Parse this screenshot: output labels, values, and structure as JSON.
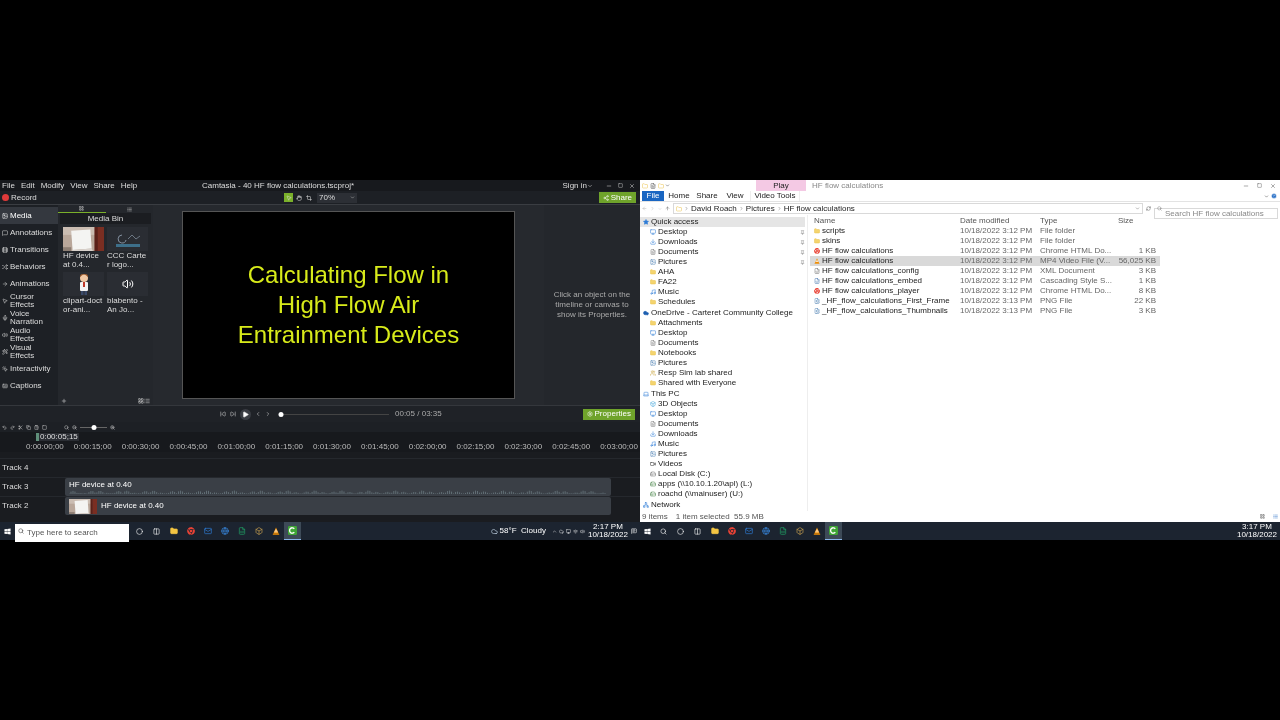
{
  "camtasia": {
    "menu": [
      "File",
      "Edit",
      "Modify",
      "View",
      "Share",
      "Help"
    ],
    "title": "Camtasia - 40 HF flow calculations.tscproj*",
    "sign_in": "Sign in",
    "record": "Record",
    "tools": [
      {
        "kind": "select",
        "selected": true
      },
      {
        "kind": "pan",
        "selected": false
      },
      {
        "kind": "crop",
        "selected": false
      }
    ],
    "zoom": "70%",
    "share": "Share",
    "sidebar": [
      {
        "label": "Media",
        "kind": "media",
        "selected": true
      },
      {
        "label": "Annotations",
        "kind": "annotations",
        "selected": false
      },
      {
        "label": "Transitions",
        "kind": "transitions",
        "selected": false
      },
      {
        "label": "Behaviors",
        "kind": "behaviors",
        "selected": false
      },
      {
        "label": "Animations",
        "kind": "animations",
        "selected": false
      },
      {
        "label": "Cursor Effects",
        "kind": "cursor",
        "selected": false
      },
      {
        "label": "Voice Narration",
        "kind": "mic",
        "selected": false
      },
      {
        "label": "Audio Effects",
        "kind": "audio",
        "selected": false
      },
      {
        "label": "Visual Effects",
        "kind": "visual",
        "selected": false
      },
      {
        "label": "Interactivity",
        "kind": "interactivity",
        "selected": false
      },
      {
        "label": "Captions",
        "kind": "captions",
        "selected": false
      }
    ],
    "media_bin": {
      "tabs": [
        {
          "kind": "bin",
          "selected": true
        },
        {
          "kind": "list",
          "selected": false
        }
      ],
      "title": "Media Bin",
      "items": [
        {
          "kind": "video",
          "label": "HF device at 0.4..."
        },
        {
          "kind": "logo",
          "label": "CCC Carter logo..."
        },
        {
          "kind": "clipart",
          "label": "clipart-doctor-ani..."
        },
        {
          "kind": "audio",
          "label": "blabento - An Jo..."
        }
      ]
    },
    "slide": {
      "lines": [
        "Calculating Flow in",
        "High Flow Air",
        "Entrainment Devices"
      ]
    },
    "properties_hint": "Click an object on the timeline or canvas to show its Properties.",
    "scrubber": {
      "level": 0.02
    },
    "time": "00:05 / 03:35",
    "properties_button": "Properties",
    "zoom_slider": {
      "level": 0.5
    },
    "playhead": "0:00:05;15",
    "ruler": [
      "0:00:00;00",
      "0:00:15;00",
      "0:00:30;00",
      "0:00:45;00",
      "0:01:00;00",
      "0:01:15;00",
      "0:01:30;00",
      "0:01:45;00",
      "0:02:00;00",
      "0:02:15;00",
      "0:02:30;00",
      "0:02:45;00",
      "0:03:00;00"
    ],
    "tracks": [
      {
        "name": "Track 4"
      },
      {
        "name": "Track 3",
        "clip": {
          "kind": "audio",
          "label": "HF device at 0.40"
        }
      },
      {
        "name": "Track 2",
        "clip": {
          "kind": "video",
          "label": "HF device at 0.40"
        }
      }
    ]
  },
  "left_taskbar": {
    "search": {
      "placeholder": "Type here to search"
    },
    "apps": [
      {
        "kind": "cortana",
        "selected": false
      },
      {
        "kind": "taskview",
        "selected": false
      },
      {
        "kind": "explorer",
        "selected": false
      },
      {
        "kind": "chrome",
        "selected": false
      },
      {
        "kind": "outlook",
        "selected": false
      },
      {
        "kind": "globe",
        "selected": false
      },
      {
        "kind": "excel",
        "selected": false
      },
      {
        "kind": "app",
        "selected": false
      },
      {
        "kind": "vlc",
        "selected": false
      },
      {
        "kind": "camtasia",
        "selected": true
      }
    ],
    "weather": "58°F  Cloudy",
    "time": "2:17 PM",
    "date": "10/18/2022"
  },
  "explorer": {
    "title": "HF flow calculations",
    "contextual_group": "Play",
    "ribbon_tabs": [
      {
        "label": "File",
        "kind": "file"
      },
      {
        "label": "Home",
        "kind": "tab"
      },
      {
        "label": "Share",
        "kind": "tab"
      },
      {
        "label": "View",
        "kind": "tab"
      },
      {
        "label": "Video Tools",
        "kind": "contextual"
      }
    ],
    "path": [
      "David Roach",
      "Pictures",
      "HF flow calculations"
    ],
    "search": {
      "placeholder": "Search HF flow calculations"
    },
    "nav": [
      {
        "label": "Quick access",
        "kind": "star",
        "selected": true,
        "children": [
          {
            "label": "Desktop",
            "kind": "desktop",
            "pinned": true,
            "selected": false
          },
          {
            "label": "Downloads",
            "kind": "download",
            "pinned": true,
            "selected": false
          },
          {
            "label": "Documents",
            "kind": "document",
            "pinned": true,
            "selected": false
          },
          {
            "label": "Pictures",
            "kind": "pictures",
            "pinned": true,
            "selected": false
          },
          {
            "label": "AHA",
            "kind": "folder",
            "pinned": false,
            "selected": false
          },
          {
            "label": "FA22",
            "kind": "folder",
            "pinned": false,
            "selected": false
          },
          {
            "label": "Music",
            "kind": "music",
            "pinned": false,
            "selected": false
          },
          {
            "label": "Schedules",
            "kind": "folder",
            "pinned": false,
            "selected": false
          }
        ]
      },
      {
        "label": "OneDrive - Carteret Community College",
        "kind": "cloud",
        "selected": false,
        "children": [
          {
            "label": "Attachments",
            "kind": "folder",
            "selected": false
          },
          {
            "label": "Desktop",
            "kind": "desktop",
            "selected": false
          },
          {
            "label": "Documents",
            "kind": "document",
            "selected": false
          },
          {
            "label": "Notebooks",
            "kind": "folder",
            "selected": false
          },
          {
            "label": "Pictures",
            "kind": "pictures",
            "selected": false
          },
          {
            "label": "Resp Sim lab shared",
            "kind": "shared",
            "selected": false
          },
          {
            "label": "Shared with Everyone",
            "kind": "folder",
            "selected": false
          }
        ]
      },
      {
        "label": "This PC",
        "kind": "pc",
        "selected": false,
        "children": [
          {
            "label": "3D Objects",
            "kind": "objects",
            "selected": false
          },
          {
            "label": "Desktop",
            "kind": "desktop",
            "selected": false
          },
          {
            "label": "Documents",
            "kind": "document",
            "selected": false
          },
          {
            "label": "Downloads",
            "kind": "download",
            "selected": false
          },
          {
            "label": "Music",
            "kind": "music",
            "selected": false
          },
          {
            "label": "Pictures",
            "kind": "pictures",
            "selected": false
          },
          {
            "label": "Videos",
            "kind": "videos",
            "selected": false
          },
          {
            "label": "Local Disk (C:)",
            "kind": "disk",
            "selected": false
          },
          {
            "label": "apps (\\\\10.10.1.20\\apl) (L:)",
            "kind": "netdrive",
            "selected": false
          },
          {
            "label": "roachd (\\\\mainuser) (U:)",
            "kind": "netdrive",
            "selected": false
          }
        ]
      },
      {
        "label": "Network",
        "kind": "network",
        "selected": false
      }
    ],
    "columns": [
      "Name",
      "Date modified",
      "Type",
      "Size"
    ],
    "rows": [
      {
        "kind": "folder",
        "name": "scripts",
        "date": "10/18/2022 3:12 PM",
        "type": "File folder",
        "selected": false
      },
      {
        "kind": "folder",
        "name": "skins",
        "date": "10/18/2022 3:12 PM",
        "type": "File folder",
        "selected": false
      },
      {
        "kind": "chrome",
        "name": "HF flow calculations",
        "date": "10/18/2022 3:12 PM",
        "type": "Chrome HTML Do...",
        "size": "1 KB",
        "selected": false
      },
      {
        "kind": "vlc",
        "name": "HF flow calculations",
        "date": "10/18/2022 3:12 PM",
        "type": "MP4 Video File (V...",
        "size": "56,025 KB",
        "selected": true
      },
      {
        "kind": "xml",
        "name": "HF flow calculations_config",
        "date": "10/18/2022 3:12 PM",
        "type": "XML Document",
        "size": "3 KB",
        "selected": false
      },
      {
        "kind": "css",
        "name": "HF flow calculations_embed",
        "date": "10/18/2022 3:12 PM",
        "type": "Cascading Style S...",
        "size": "1 KB",
        "selected": false
      },
      {
        "kind": "chrome",
        "name": "HF flow calculations_player",
        "date": "10/18/2022 3:12 PM",
        "type": "Chrome HTML Do...",
        "size": "8 KB",
        "selected": false
      },
      {
        "kind": "png",
        "name": "_HF_flow_calculations_First_Frame",
        "date": "10/18/2022 3:13 PM",
        "type": "PNG File",
        "size": "22 KB",
        "selected": false
      },
      {
        "kind": "png",
        "name": "_HF_flow_calculations_Thumbnails",
        "date": "10/18/2022 3:13 PM",
        "type": "PNG File",
        "size": "3 KB",
        "selected": false
      }
    ],
    "status": [
      "9 items",
      "1 item selected  55.9 MB"
    ]
  },
  "right_taskbar": {
    "apps": [
      {
        "kind": "search",
        "selected": false
      },
      {
        "kind": "cortana",
        "selected": false
      },
      {
        "kind": "taskview",
        "selected": false
      },
      {
        "kind": "explorer",
        "selected": false
      },
      {
        "kind": "chrome",
        "selected": false
      },
      {
        "kind": "outlook",
        "selected": false
      },
      {
        "kind": "globe",
        "selected": false
      },
      {
        "kind": "excel",
        "selected": false
      },
      {
        "kind": "app",
        "selected": false
      },
      {
        "kind": "vlc",
        "selected": false
      },
      {
        "kind": "camtasia",
        "selected": true
      }
    ],
    "time": "3:17 PM",
    "date": "10/18/2022"
  }
}
